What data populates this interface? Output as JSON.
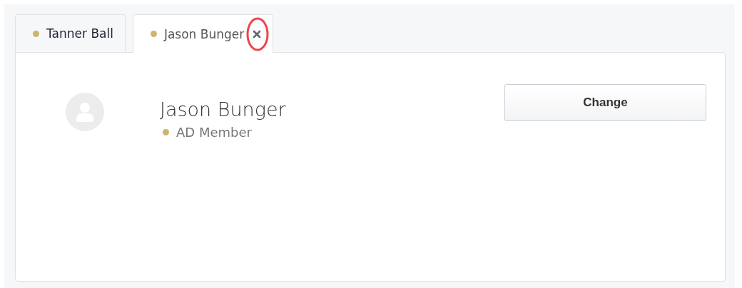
{
  "tabs": [
    {
      "label": "Tanner Ball",
      "color": "#cdb56a",
      "selected": false,
      "closable": false
    },
    {
      "label": "Jason Bunger",
      "color": "#cdb56a",
      "selected": true,
      "closable": true
    }
  ],
  "profile": {
    "name": "Jason Bunger",
    "role": "AD Member",
    "color": "#cdb56a"
  },
  "buttons": [
    "Change"
  ]
}
